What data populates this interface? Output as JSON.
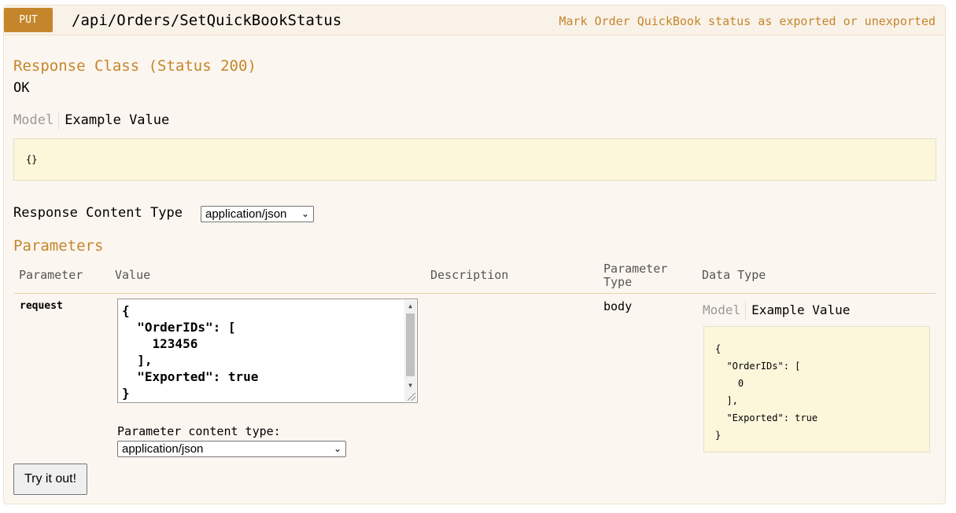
{
  "operation": {
    "method": "PUT",
    "path": "/api/Orders/SetQuickBookStatus",
    "summary": "Mark Order QuickBook status as exported or unexported"
  },
  "response_class": {
    "heading": "Response Class (Status 200)",
    "status_text": "OK",
    "tabs": {
      "model": "Model",
      "example": "Example Value"
    },
    "example_value": "{}"
  },
  "response_content_type": {
    "label": "Response Content Type",
    "selected": "application/json"
  },
  "parameters": {
    "heading": "Parameters",
    "columns": {
      "parameter": "Parameter",
      "value": "Value",
      "description": "Description",
      "parameter_type": "Parameter\nType",
      "data_type": "Data Type"
    },
    "rows": [
      {
        "name": "request",
        "value": "{\n  \"OrderIDs\": [\n    123456\n  ],\n  \"Exported\": true\n}",
        "description": "",
        "param_type": "body",
        "data_type_tabs": {
          "model": "Model",
          "example": "Example Value"
        },
        "data_type_example": "{\n  \"OrderIDs\": [\n    0\n  ],\n  \"Exported\": true\n}",
        "content_type_label": "Parameter content type:",
        "content_type_selected": "application/json"
      }
    ]
  },
  "actions": {
    "try_it_label": "Try it out!"
  },
  "colors": {
    "accent": "#c5862b",
    "background": "#fcf6f0",
    "example_bg": "#fcf6db"
  }
}
